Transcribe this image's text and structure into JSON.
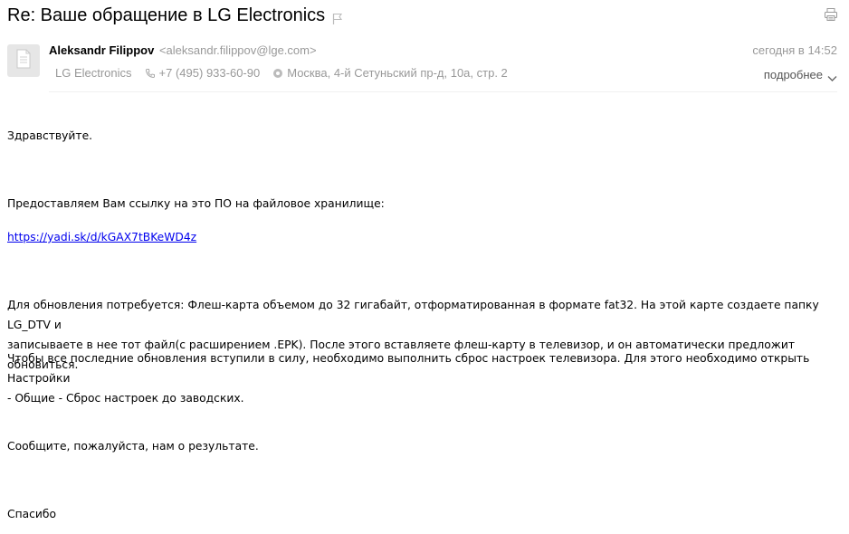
{
  "subject": "Re: Ваше обращение в LG Electronics",
  "sender": {
    "name": "Aleksandr Filippov",
    "email": "<aleksandr.filippov@lge.com>",
    "company": "LG Electronics",
    "phone": "+7 (495) 933-60-90",
    "address": "Москва, 4-й Сетуньский пр-д, 10а, стр. 2"
  },
  "date": "сегодня в 14:52",
  "details_label": "подробнее",
  "body": {
    "greeting": "Здравствуйте.",
    "p1": "Предоставляем Вам ссылку на это ПО на файловое хранилище:",
    "link": "https://yadi.sk/d/kGAX7tBKeWD4z",
    "p2_line1": "Для обновления потребуется: Флеш-карта объемом до 32 гигабайт, отформатированная в формате fat32. На этой карте создаете папку LG_DTV и",
    "p2_line2": "записываете в нее тот файл(с расширением .EPK). После этого вставляете флеш-карту в телевизор, и он автоматически предложит обновиться.",
    "p3_line1": "Чтобы все последние обновления вступили в силу, необходимо выполнить сброс настроек телевизора. Для этого необходимо открыть Настройки",
    "p3_line2": "- Общие - Сброс настроек до заводских.",
    "p4": "Сообщите, пожалуйста, нам о результате.",
    "closing": "Спасибо"
  },
  "icons": {
    "flag": "flag-icon",
    "print": "print-icon",
    "avatar": "document-icon",
    "phone": "phone-icon",
    "location": "location-pin-icon",
    "chevron": "chevron-down-icon"
  },
  "colors": {
    "link": "#0000ee",
    "muted": "#999999",
    "avatar_bg": "#e6e6e6"
  }
}
